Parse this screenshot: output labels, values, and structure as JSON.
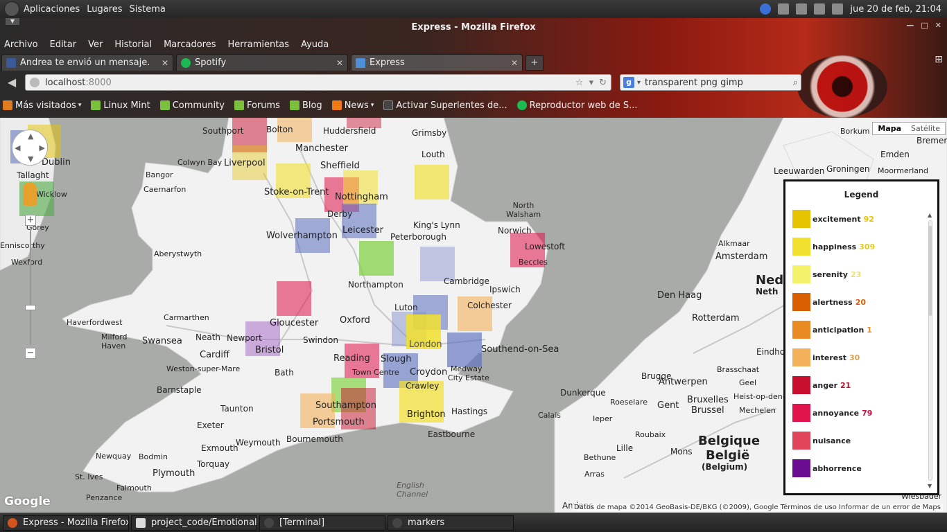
{
  "top_panel": {
    "menus": [
      "Aplicaciones",
      "Lugares",
      "Sistema"
    ],
    "clock": "jue 20 de feb, 21:04"
  },
  "window": {
    "title": "Express - Mozilla Firefox"
  },
  "menubar": [
    "Archivo",
    "Editar",
    "Ver",
    "Historial",
    "Marcadores",
    "Herramientas",
    "Ayuda"
  ],
  "tabs": [
    {
      "label": "Andrea te envió un mensaje.",
      "color": "#3b5998"
    },
    {
      "label": "Spotify",
      "color": "#1db954"
    },
    {
      "label": "Express",
      "color": "#4f8fd8"
    }
  ],
  "url": {
    "host": "localhost",
    "port": ":8000"
  },
  "search": {
    "value": "transparent png gimp"
  },
  "bookmarks": [
    {
      "label": "Más visitados",
      "color": "#e07b20"
    },
    {
      "label": "Linux Mint",
      "color": "#7cbf3c"
    },
    {
      "label": "Community",
      "color": "#7cbf3c"
    },
    {
      "label": "Forums",
      "color": "#7cbf3c"
    },
    {
      "label": "Blog",
      "color": "#7cbf3c"
    },
    {
      "label": "News",
      "color": "#f07a14"
    },
    {
      "label": "Activar Superlentes de...",
      "color": "#444444"
    },
    {
      "label": "Reproductor web de S...",
      "color": "#1db954"
    }
  ],
  "map": {
    "type_buttons": {
      "map": "Mapa",
      "satellite": "Satélite"
    },
    "google_logo": "Google",
    "attribution": "Datos de mapa ©2014 GeoBasis-DE/BKG (©2009), Google   Términos de uso   Informar de un error de Maps",
    "labels": [
      "Southport",
      "Bolton",
      "Huddersfield",
      "Grimsby",
      "Manchester",
      "Liverpool",
      "Sheffield",
      "Louth",
      "Dublin",
      "Tallaght",
      "Wicklow",
      "Gorey",
      "Colwyn Bay",
      "Bangor",
      "Caernarfon",
      "Stoke-on-Trent",
      "Nottingham",
      "Derby",
      "Leicester",
      "Wolverhampton",
      "Aberystwyth",
      "King's Lynn",
      "Norwich",
      "Lowestoft",
      "Beccles",
      "Peterborough",
      "Northampton",
      "Cambridge",
      "Ipswich",
      "Colchester",
      "Luton",
      "Oxford",
      "Gloucester",
      "Carmarthen",
      "Haverfordwest",
      "Swansea",
      "Neath",
      "Newport",
      "Cardiff",
      "Bristol",
      "Swindon",
      "Reading",
      "Slough",
      "London",
      "Southend-on-Sea",
      "Medway",
      "City Estate",
      "Croydon",
      "Crawley",
      "Brighton",
      "Hastings",
      "Eastbourne",
      "Southampton",
      "Portsmouth",
      "Bath",
      "Barnstaple",
      "Taunton",
      "Exeter",
      "Weymouth",
      "Bournemouth",
      "Exmouth",
      "Torquay",
      "Plymouth",
      "Newquay",
      "Bodmin",
      "St. Ives",
      "Falmouth",
      "Penzance",
      "Milford Haven",
      "Town Centre",
      "Weston-super-Mare",
      "English Channel",
      "Wexford",
      "Enniscorthy",
      "Borkum",
      "Bremer",
      "Emden",
      "Leeuwarden",
      "Groningen",
      "Moormerland",
      "Alkmaar",
      "Amsterdam",
      "Ned",
      "Neth",
      "Den Haag",
      "Rotterdam",
      "Eindho",
      "Brugge",
      "Antwerpen",
      "Gent",
      "Brussel",
      "Bruxelles",
      "Dunkerque",
      "Roeselare",
      "Calais",
      "Ieper",
      "Lille",
      "Roubaix",
      "Mons",
      "Belgique",
      "België",
      "(Belgium)",
      "Bethune",
      "Arras",
      "Amiens",
      "Wiesbader",
      "Geel",
      "Brasschaat",
      "Heist-op-den-",
      "Mechelen",
      "North Walsham"
    ]
  },
  "legend": {
    "title": "Legend",
    "items": [
      {
        "name": "excitement",
        "count": "92",
        "color": "#e5c300"
      },
      {
        "name": "happiness",
        "count": "309",
        "color": "#f2e02e"
      },
      {
        "name": "serenity",
        "count": "23",
        "color": "#f4f26a"
      },
      {
        "name": "alertness",
        "count": "20",
        "color": "#d95f02"
      },
      {
        "name": "anticipation",
        "count": "1",
        "color": "#ea8a22"
      },
      {
        "name": "interest",
        "count": "30",
        "color": "#f2b15a"
      },
      {
        "name": "anger",
        "count": "21",
        "color": "#c8102e"
      },
      {
        "name": "annoyance",
        "count": "79",
        "color": "#e0134a"
      },
      {
        "name": "nuisance",
        "count": "",
        "color": "#e0455a"
      },
      {
        "name": "abhorrence",
        "count": "",
        "color": "#6a0d91"
      }
    ]
  },
  "taskbar": [
    {
      "label": "Express - Mozilla Firefox",
      "color": "#d2541f"
    },
    {
      "label": "project_code/Emotional...",
      "color": "#dcdcdc"
    },
    {
      "label": "[Terminal]",
      "color": "#444444"
    },
    {
      "label": "markers",
      "color": "#444444"
    }
  ]
}
